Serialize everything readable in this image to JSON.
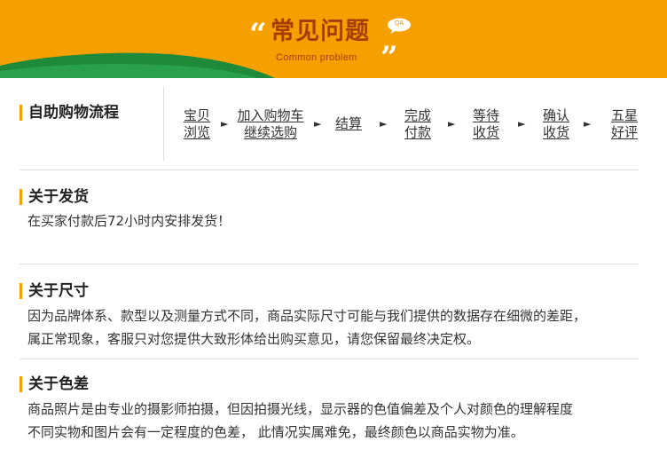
{
  "banner": {
    "title": "常见问题",
    "subtitle": "Common problem",
    "badge": "QA",
    "quote_open": "“",
    "quote_close": "”"
  },
  "shopping_flow": {
    "title": "自助购物流程",
    "steps": [
      {
        "line1": "宝贝",
        "line2": "浏览"
      },
      {
        "line1": "加入购物车",
        "line2": "继续选购"
      },
      {
        "line1": "结算",
        "line2": ""
      },
      {
        "line1": "完成",
        "line2": "付款"
      },
      {
        "line1": "等待",
        "line2": "收货"
      },
      {
        "line1": "确认",
        "line2": "收货"
      },
      {
        "line1": "五星",
        "line2": "好评"
      }
    ],
    "arrow": "►"
  },
  "shipping": {
    "title": "关于发货",
    "text": "在买家付款后72小时内安排发货！"
  },
  "size": {
    "title": "关于尺寸",
    "line1": "因为品牌体系、款型以及测量方式不同，商品实际尺寸可能与我们提供的数据存在细微的差距，",
    "line2": "属正常现象，客服只对您提供大致形体给出购买意见，请您保留最终决定权。"
  },
  "color": {
    "title": "关于色差",
    "line1": "商品照片是由专业的摄影师拍摄，但因拍摄光线，显示器的色值偏差及个人对颜色的理解程度",
    "line2": "不同实物和图片会有一定程度的色差， 此情况实属难免，最终颜色以商品实物为准。"
  },
  "colors": {
    "banner": "#f5a000",
    "title_brown": "#a83c05",
    "hill_green": "#1f8a3a",
    "accent_bar": "#f5a000"
  }
}
